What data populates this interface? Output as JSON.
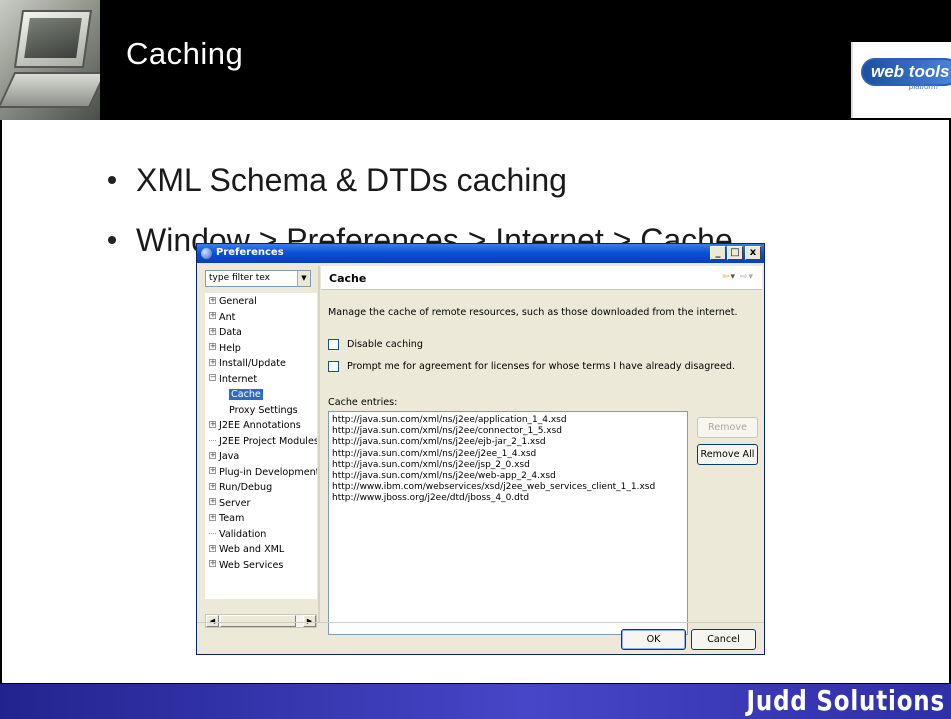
{
  "slide": {
    "title": "Caching",
    "logo_text": "web tools",
    "logo_sub": "platform",
    "bullets": [
      "XML Schema & DTDs caching",
      "Window > Preferences > Internet > Cache"
    ],
    "footer_brand": "Judd Solutions"
  },
  "dialog": {
    "title": "Preferences",
    "window_buttons": {
      "minimize": "_",
      "maximize": "□",
      "close": "x"
    },
    "filter_placeholder": "type filter tex",
    "tree": [
      {
        "label": "General",
        "expander": "+"
      },
      {
        "label": "Ant",
        "expander": "+"
      },
      {
        "label": "Data",
        "expander": "+"
      },
      {
        "label": "Help",
        "expander": "+"
      },
      {
        "label": "Install/Update",
        "expander": "+"
      },
      {
        "label": "Internet",
        "expander": "−"
      },
      {
        "label": "Cache",
        "child": true,
        "selected": true
      },
      {
        "label": "Proxy Settings",
        "child": true
      },
      {
        "label": "J2EE Annotations",
        "expander": "+"
      },
      {
        "label": "J2EE Project Modules"
      },
      {
        "label": "Java",
        "expander": "+"
      },
      {
        "label": "Plug-in Development",
        "expander": "+"
      },
      {
        "label": "Run/Debug",
        "expander": "+"
      },
      {
        "label": "Server",
        "expander": "+"
      },
      {
        "label": "Team",
        "expander": "+"
      },
      {
        "label": "Validation"
      },
      {
        "label": "Web and XML",
        "expander": "+"
      },
      {
        "label": "Web Services",
        "expander": "+"
      }
    ],
    "page": {
      "title": "Cache",
      "description": "Manage the cache of remote resources, such as those downloaded from the internet.",
      "disable_caching_label": "Disable caching",
      "disable_caching_checked": false,
      "prompt_label": "Prompt me for agreement for licenses for whose terms I have already disagreed.",
      "prompt_checked": false,
      "entries_label": "Cache entries:",
      "entries": [
        "http://java.sun.com/xml/ns/j2ee/application_1_4.xsd",
        "http://java.sun.com/xml/ns/j2ee/connector_1_5.xsd",
        "http://java.sun.com/xml/ns/j2ee/ejb-jar_2_1.xsd",
        "http://java.sun.com/xml/ns/j2ee/j2ee_1_4.xsd",
        "http://java.sun.com/xml/ns/j2ee/jsp_2_0.xsd",
        "http://java.sun.com/xml/ns/j2ee/web-app_2_4.xsd",
        "http://www.ibm.com/webservices/xsd/j2ee_web_services_client_1_1.xsd",
        "http://www.jboss.org/j2ee/dtd/jboss_4_0.dtd"
      ],
      "remove_label": "Remove",
      "remove_all_label": "Remove All"
    },
    "ok_label": "OK",
    "cancel_label": "Cancel"
  },
  "colors": {
    "footer_blue": "#3a3ab8",
    "titlebar_blue": "#0a4fd3",
    "selection_blue": "#316ac5"
  }
}
